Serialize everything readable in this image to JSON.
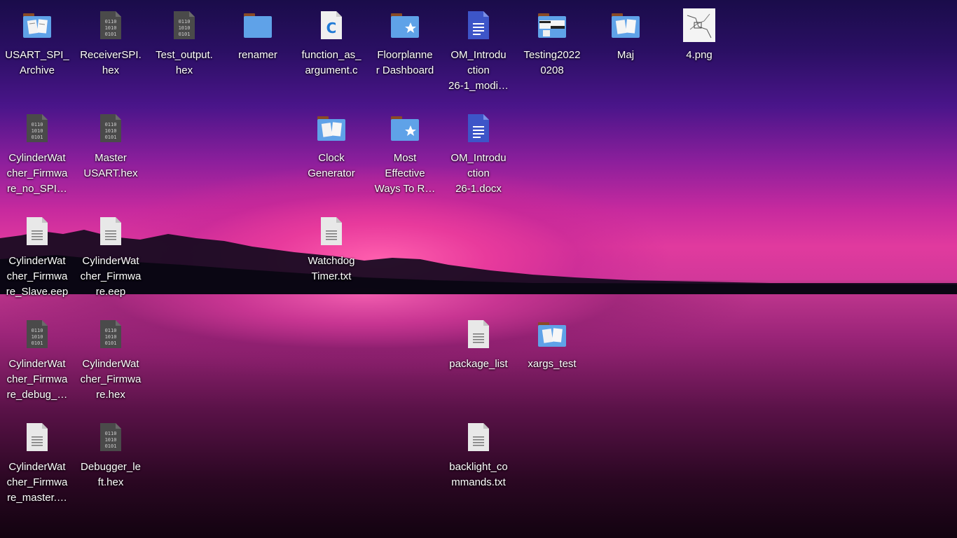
{
  "desktop": {
    "icons": [
      {
        "label": "USART_SPI_\nArchive",
        "icon": "folder-images-icon"
      },
      {
        "label": "ReceiverSPI.\nhex",
        "icon": "binary-file-icon"
      },
      {
        "label": "Test_output.\nhex",
        "icon": "binary-file-icon"
      },
      {
        "label": "renamer",
        "icon": "folder-icon"
      },
      {
        "label": "function_as_\nargument.c",
        "icon": "c-source-file-icon"
      },
      {
        "label": "Floorplanne\nr Dashboard",
        "icon": "folder-favorite-icon"
      },
      {
        "label": "OM_Introdu\nction\n26-1_modi…",
        "icon": "document-icon"
      },
      {
        "label": "Testing2022\n0208",
        "icon": "folder-images-icon"
      },
      {
        "label": "Maj",
        "icon": "folder-images-icon"
      },
      {
        "label": "4.png",
        "icon": "image-thumbnail-icon"
      },
      {
        "label": "CylinderWat\ncher_Firmwa\nre_no_SPI…",
        "icon": "binary-file-icon"
      },
      {
        "label": "Master\nUSART.hex",
        "icon": "binary-file-icon"
      },
      {
        "label": "Clock\nGenerator",
        "icon": "folder-images-icon"
      },
      {
        "label": "Most\nEffective\nWays To R…",
        "icon": "folder-favorite-icon"
      },
      {
        "label": "OM_Introdu\nction\n26-1.docx",
        "icon": "document-icon"
      },
      {
        "label": "CylinderWat\ncher_Firmwa\nre_Slave.eep",
        "icon": "text-file-icon"
      },
      {
        "label": "CylinderWat\ncher_Firmwa\nre.eep",
        "icon": "text-file-icon"
      },
      {
        "label": "Watchdog\nTimer.txt",
        "icon": "text-file-icon"
      },
      {
        "label": "CylinderWat\ncher_Firmwa\nre_debug_…",
        "icon": "binary-file-icon"
      },
      {
        "label": "CylinderWat\ncher_Firmwa\nre.hex",
        "icon": "binary-file-icon"
      },
      {
        "label": "package_list",
        "icon": "text-file-icon"
      },
      {
        "label": "xargs_test",
        "icon": "folder-images-icon"
      },
      {
        "label": "CylinderWat\ncher_Firmwa\nre_master.…",
        "icon": "text-file-icon"
      },
      {
        "label": "Debugger_le\nft.hex",
        "icon": "binary-file-icon"
      },
      {
        "label": "backlight_co\nmmands.txt",
        "icon": "text-file-icon"
      }
    ]
  },
  "colors": {
    "folder": "#5fa2e8",
    "folder_tab": "#8a4a25",
    "binary": "#4a4a4a",
    "document": "#3d55c8",
    "text_file": "#e8e8e8"
  }
}
